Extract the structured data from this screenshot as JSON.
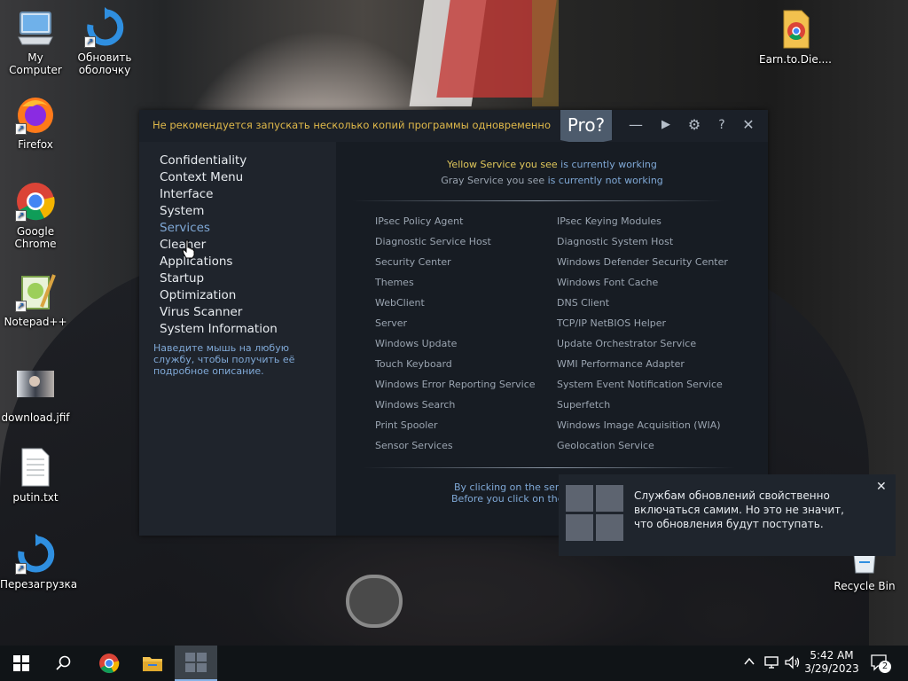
{
  "desktop": {
    "icons": [
      {
        "label": "My Computer"
      },
      {
        "label": "Обновить оболочку"
      },
      {
        "label": "Firefox"
      },
      {
        "label": "Google Chrome"
      },
      {
        "label": "Notepad++"
      },
      {
        "label": "download.jfif"
      },
      {
        "label": "putin.txt"
      },
      {
        "label": "Перезагрузка"
      },
      {
        "label": "Earn.to.Die...."
      },
      {
        "label": "Recycle Bin"
      }
    ]
  },
  "window": {
    "warning": "Не рекомендуется запускать несколько копий программы одновременно",
    "pro_label": "Pro?",
    "controls": {
      "minimize": "—",
      "play": "▶",
      "settings": "⚙",
      "help": "?",
      "close": "✕"
    },
    "sidebar": {
      "items": [
        {
          "label": "Confidentiality"
        },
        {
          "label": "Context Menu"
        },
        {
          "label": "Interface"
        },
        {
          "label": "System"
        },
        {
          "label": "Services"
        },
        {
          "label": "Cleaner"
        },
        {
          "label": "Applications"
        },
        {
          "label": "Startup"
        },
        {
          "label": "Optimization"
        },
        {
          "label": "Virus Scanner"
        },
        {
          "label": "System Information"
        }
      ],
      "active": "Services",
      "hint": "Наведите мышь на любую службу, чтобы получить её подробное описание."
    },
    "legend": {
      "line1_colored": "Yellow Service you see",
      "line1_rest": " is currently working",
      "line2_colored": "Gray Service you see",
      "line2_rest": " is currently not working"
    },
    "services_left": [
      "IPsec Policy Agent",
      "Diagnostic Service Host",
      "Security Center",
      "Themes",
      "WebClient",
      "Server",
      "Windows Update",
      "Touch Keyboard",
      "Windows Error Reporting Service",
      "Windows Search",
      "Print Spooler",
      "Sensor Services"
    ],
    "services_right": [
      "IPsec Keying Modules",
      "Diagnostic System Host",
      "Windows Defender Security Center",
      "Windows Font Cache",
      "DNS Client",
      "TCP/IP NetBIOS Helper",
      "Update Orchestrator Service",
      "WMI Performance Adapter",
      "System Event Notification Service",
      "Superfetch",
      "Windows Image Acquisition (WIA)",
      "Geolocation Service"
    ],
    "bottom_note": {
      "line1": "By clicking on the service",
      "line2": "Before you click on them,"
    }
  },
  "toast": {
    "message": "Службам обновлений свойственно включаться самим. Но это не значит, что обновления будут поступать.",
    "close": "✕"
  },
  "taskbar": {
    "time": "5:42 AM",
    "date": "3/29/2023",
    "notifications": "2"
  },
  "colors": {
    "accent_blue": "#7fa8d6",
    "warning_yellow": "#e0b94a",
    "service_gray": "#9aa4b0"
  }
}
